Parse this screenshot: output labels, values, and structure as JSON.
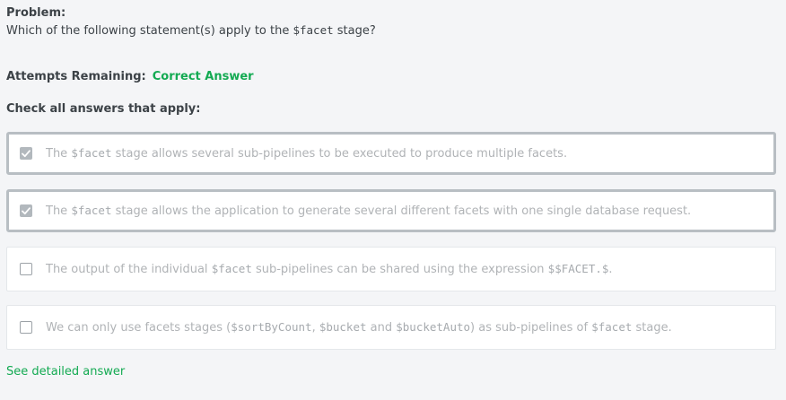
{
  "problem": {
    "title": "Problem:",
    "question_prefix": "Which of the following statement(s) apply to the ",
    "question_code": "$facet",
    "question_suffix": " stage?"
  },
  "attempts": {
    "label": "Attempts Remaining:",
    "status": "Correct Answer",
    "status_color": "#13aa52"
  },
  "instructions": "Check all answers that apply:",
  "options": [
    {
      "checked": true,
      "parts": [
        {
          "t": "The "
        },
        {
          "c": "$facet"
        },
        {
          "t": " stage allows several sub-pipelines to be executed to produce multiple facets."
        }
      ]
    },
    {
      "checked": true,
      "parts": [
        {
          "t": "The "
        },
        {
          "c": "$facet"
        },
        {
          "t": " stage allows the application to generate several different facets with one single database request."
        }
      ]
    },
    {
      "checked": false,
      "parts": [
        {
          "t": "The output of the individual "
        },
        {
          "c": "$facet"
        },
        {
          "t": " sub-pipelines can be shared using the expression "
        },
        {
          "c": "$$FACET.$"
        },
        {
          "t": "."
        }
      ]
    },
    {
      "checked": false,
      "parts": [
        {
          "t": "We can only use facets stages ("
        },
        {
          "c": "$sortByCount"
        },
        {
          "t": ", "
        },
        {
          "c": "$bucket"
        },
        {
          "t": " and "
        },
        {
          "c": "$bucketAuto"
        },
        {
          "t": ") as sub-pipelines of "
        },
        {
          "c": "$facet"
        },
        {
          "t": " stage."
        }
      ]
    }
  ],
  "footer_link": "See detailed answer",
  "icons": {
    "checked": "checkbox-checked-icon",
    "unchecked": "checkbox-empty-icon"
  }
}
